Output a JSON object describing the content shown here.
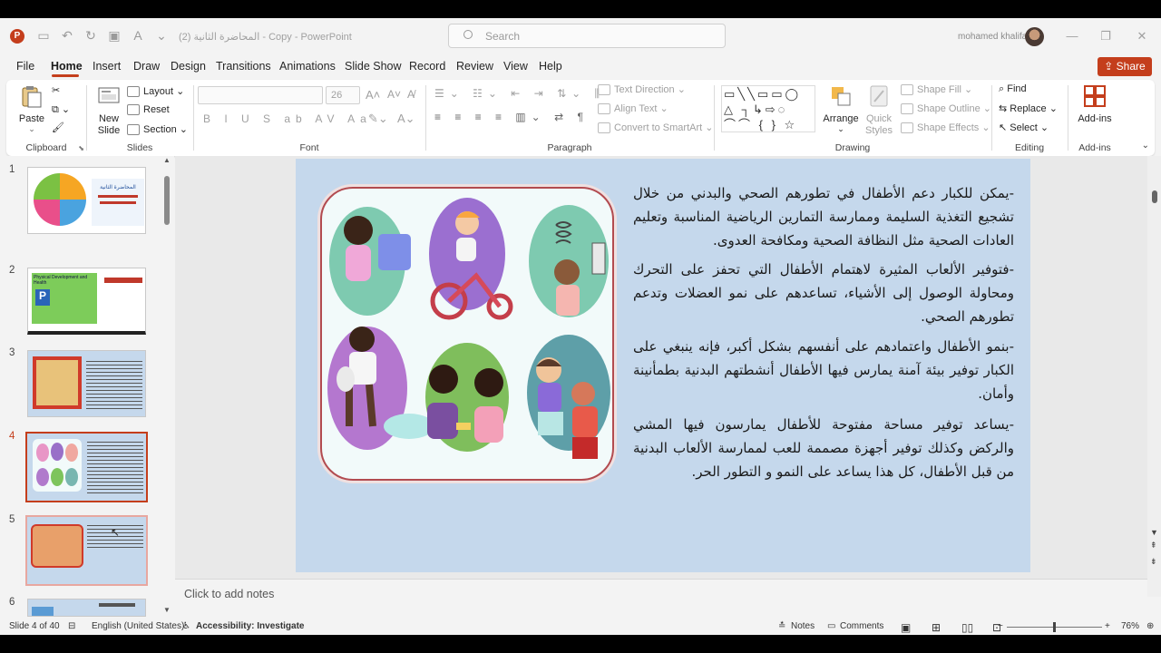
{
  "app": {
    "title": "المحاضرة الثانية (2) - Copy  -  PowerPoint",
    "search_placeholder": "Search",
    "user_name": "mohamed khalifa",
    "logo_letter": "P"
  },
  "menu": {
    "items": [
      "File",
      "Home",
      "Insert",
      "Draw",
      "Design",
      "Transitions",
      "Animations",
      "Slide Show",
      "Record",
      "Review",
      "View",
      "Help"
    ],
    "active": "Home",
    "share_label": "Share"
  },
  "ribbon": {
    "clipboard": {
      "label": "Clipboard",
      "paste": "Paste"
    },
    "slides": {
      "label": "Slides",
      "new_slide": "New Slide",
      "layout": "Layout",
      "reset": "Reset",
      "section": "Section"
    },
    "font": {
      "label": "Font",
      "size": "26",
      "format_glyphs": "B I U S ab AV Aa"
    },
    "paragraph": {
      "label": "Paragraph",
      "text_direction": "Text Direction",
      "align_text": "Align Text",
      "convert_smartart": "Convert to SmartArt"
    },
    "drawing": {
      "label": "Drawing",
      "arrange": "Arrange",
      "quick_styles": "Quick Styles",
      "shape_fill": "Shape Fill",
      "shape_outline": "Shape Outline",
      "shape_effects": "Shape Effects"
    },
    "editing": {
      "label": "Editing",
      "find": "Find",
      "replace": "Replace",
      "select": "Select"
    },
    "addins": {
      "label": "Add-ins",
      "button": "Add-ins"
    }
  },
  "thumbnails": [
    {
      "num": "1",
      "state": "normal",
      "title": "المحاضرة الثانية"
    },
    {
      "num": "2",
      "state": "normal",
      "title": "Physical Development and Health"
    },
    {
      "num": "3",
      "state": "normal"
    },
    {
      "num": "4",
      "state": "active"
    },
    {
      "num": "5",
      "state": "hover"
    },
    {
      "num": "6",
      "state": "normal"
    }
  ],
  "slide": {
    "paragraphs": [
      "-يمكن للكبار دعم الأطفال في تطورهم الصحي والبدني من خلال تشجيع التغذية السليمة وممارسة التمارين الرياضية المناسبة وتعليم العادات الصحية مثل النظافة الصحية ومكافحة العدوى.",
      "-فتوفير الألعاب المثيرة لاهتمام الأطفال التي تحفز على التحرك ومحاولة الوصول إلى الأشياء، تساعدهم على نمو العضلات وتدعم تطورهم الصحي.",
      "-بنمو الأطفال واعتمادهم على أنفسهم بشكل أكبر، فإنه ينبغي على الكبار توفير بيئة آمنة يمارس فيها الأطفال أنشطتهم البدنية بطمأنينة وأمان.",
      "-يساعد توفير مساحة مفتوحة للأطفال يمارسون فيها المشي والركض وكذلك توفير أجهزة مصممة للعب لممارسة الألعاب البدنية من قبل الأطفال، كل هذا يساعد على النمو و التطور الحر."
    ]
  },
  "notes_placeholder": "Click to add notes",
  "status": {
    "slide_info": "Slide 4 of 40",
    "language": "English (United States)",
    "accessibility": "Accessibility: Investigate",
    "notes": "Notes",
    "comments": "Comments",
    "zoom": "76%"
  },
  "colors": {
    "accent": "#c43e1c",
    "slide_bg": "#c5d8ec"
  }
}
